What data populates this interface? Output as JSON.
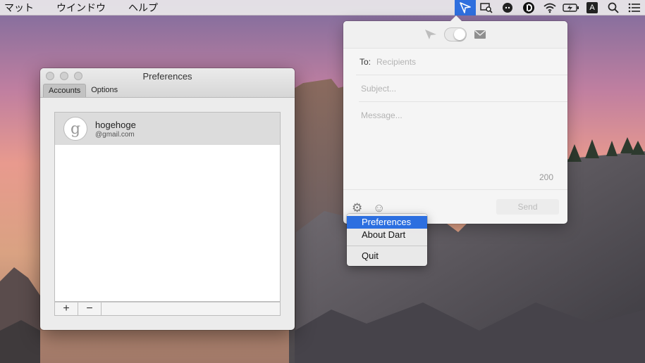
{
  "menubar": {
    "items": [
      "マット",
      "ウインドウ",
      "ヘルプ"
    ],
    "status_icons": [
      "send-icon",
      "screen-search-icon",
      "mascot-icon",
      "d-badge-icon",
      "wifi-icon",
      "battery-icon",
      "input-a-icon",
      "spotlight-icon",
      "notification-list-icon"
    ],
    "input_label": "A"
  },
  "preferences": {
    "title": "Preferences",
    "tabs": [
      "Accounts",
      "Options"
    ],
    "selected_tab": "Accounts",
    "accounts": [
      {
        "avatar_letter": "g",
        "name": "hogehoge",
        "email": "@gmail.com"
      }
    ],
    "add_label": "+",
    "remove_label": "−"
  },
  "compose": {
    "to_label": "To:",
    "to_placeholder": "Recipients",
    "subject_placeholder": "Subject...",
    "message_placeholder": "Message...",
    "char_count": "200",
    "send_label": "Send"
  },
  "dropdown": {
    "items": [
      "Preferences",
      "About Dart",
      "Quit"
    ],
    "highlighted": "Preferences"
  },
  "colors": {
    "accent": "#2c6fe0",
    "status_active": "#2f6fde"
  }
}
